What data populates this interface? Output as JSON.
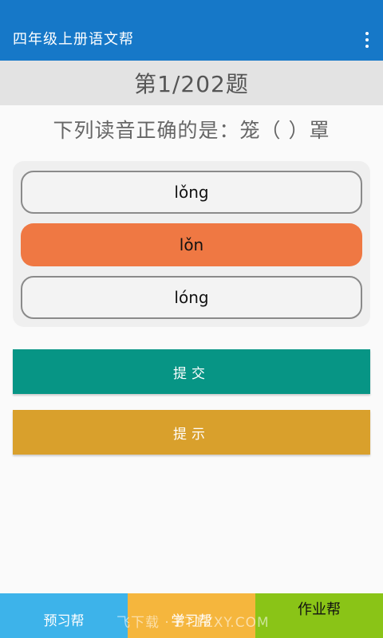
{
  "colors": {
    "primary": "#1678c8",
    "selected": "#ef7843",
    "submit": "#079585",
    "hint": "#d9a02c",
    "nav_preview": "#3db3ea",
    "nav_study": "#f5b63d",
    "nav_homework": "#8ac417"
  },
  "toolbar": {
    "title": "四年级上册语文帮",
    "menu_icon": "more-vert-icon"
  },
  "progress": {
    "label": "第1/202题"
  },
  "question": {
    "text": "下列读音正确的是：笼（ ）罩"
  },
  "options": [
    {
      "label": "lǒng",
      "selected": false
    },
    {
      "label": "lǒn",
      "selected": true
    },
    {
      "label": "lóng",
      "selected": false
    }
  ],
  "actions": {
    "submit_label": "提交",
    "hint_label": "提示"
  },
  "nav": [
    {
      "label": "预习帮"
    },
    {
      "label": "学习帮"
    },
    {
      "label": "作业帮"
    }
  ],
  "watermark": "飞下载 · BT1ZXY.COM"
}
